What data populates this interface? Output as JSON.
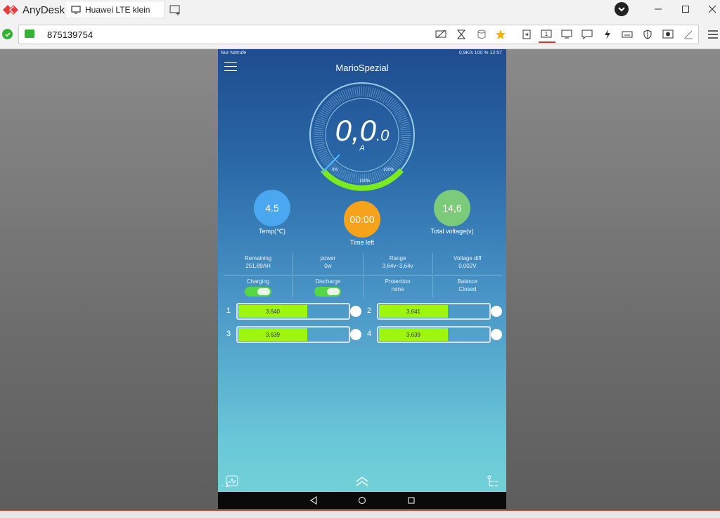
{
  "app": {
    "name": "AnyDesk",
    "tab_label": "Huawei LTE klein",
    "address": "875139754"
  },
  "phone": {
    "status_left": "Nur Notrufe",
    "status_right": "0,9K/s  100 %  12:57",
    "title": "MarioSpezial",
    "gauge": {
      "value_main": "0,0",
      "value_decimal": ".0",
      "unit": "A",
      "mark_start": "0%",
      "mark_mid": "100%",
      "mark_end": "100%",
      "arc_fraction": 0.25
    },
    "temp": {
      "value": "4.5",
      "label": "Temp(℃)",
      "color": "#4aa7f0"
    },
    "time_left": {
      "value": "00:00",
      "label": "Time left",
      "color": "#f7a21b"
    },
    "total_voltage": {
      "value": "14,6",
      "label": "Total voltage(v)",
      "color": "#7ccb7a"
    },
    "stats": [
      {
        "label": "Remaining",
        "value": "251,89AH"
      },
      {
        "label": "power",
        "value": "0w"
      },
      {
        "label": "Range",
        "value": "3,64v~3,64v"
      },
      {
        "label": "Voltage diff",
        "value": "0,002V"
      }
    ],
    "controls": [
      {
        "label": "Charging",
        "kind": "toggle",
        "on": true
      },
      {
        "label": "Discharge",
        "kind": "toggle",
        "on": true
      },
      {
        "label": "Protection",
        "value": "none"
      },
      {
        "label": "Balance",
        "value": "Closed"
      }
    ],
    "cells": [
      {
        "num": "1",
        "voltage": "3,640",
        "fill": 0.63
      },
      {
        "num": "2",
        "voltage": "3,641",
        "fill": 0.63
      },
      {
        "num": "3",
        "voltage": "3,639",
        "fill": 0.63
      },
      {
        "num": "4",
        "voltage": "3,639",
        "fill": 0.63
      }
    ],
    "bottom_left_label": "- 1"
  }
}
